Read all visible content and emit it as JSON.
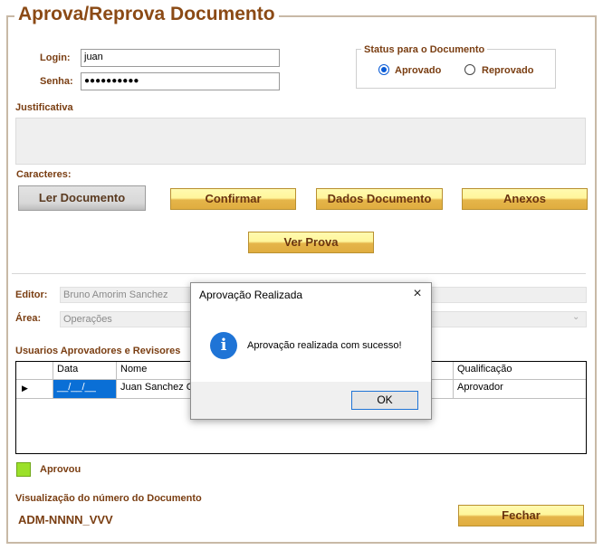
{
  "window": {
    "title": "Aprova/Reprova Documento"
  },
  "login": {
    "label": "Login:",
    "value": "juan"
  },
  "senha": {
    "label": "Senha:",
    "value": "●●●●●●●●●●"
  },
  "status_group": {
    "title": "Status para o Documento",
    "options": [
      {
        "label": "Aprovado",
        "selected": true
      },
      {
        "label": "Reprovado",
        "selected": false
      }
    ]
  },
  "justificativa": {
    "label": "Justificativa",
    "value": ""
  },
  "caracteres": {
    "label": "Caracteres:"
  },
  "buttons": {
    "ler": "Ler Documento",
    "confirmar": "Confirmar",
    "dados": "Dados Documento",
    "anexos": "Anexos",
    "ver_prova": "Ver Prova",
    "fechar": "Fechar"
  },
  "editor": {
    "label": "Editor:",
    "value": "Bruno Amorim Sanchez"
  },
  "area": {
    "label": "Área:",
    "value": "Operações"
  },
  "grid": {
    "title": "Usuarios Aprovadores e Revisores",
    "columns": [
      "Data",
      "Nome",
      "Qualificação"
    ],
    "rows": [
      {
        "data": "__/__/__",
        "nome": "Juan Sanchez C",
        "qualificacao": "Aprovador"
      }
    ]
  },
  "legend": {
    "label": "Aprovou",
    "color": "#9be02a"
  },
  "doc_number": {
    "label": "Visualização do número do Documento",
    "value": "ADM-NNNN_VVV"
  },
  "dialog": {
    "title": "Aprovação Realizada",
    "close_icon": "×",
    "info_icon": "i",
    "message": "Aprovação realizada com sucesso!",
    "ok": "OK"
  },
  "colors": {
    "label": "#7a3e12",
    "title": "#8b4a15",
    "button_yellow": "#fff69b",
    "accent_blue": "#1f74d6"
  }
}
